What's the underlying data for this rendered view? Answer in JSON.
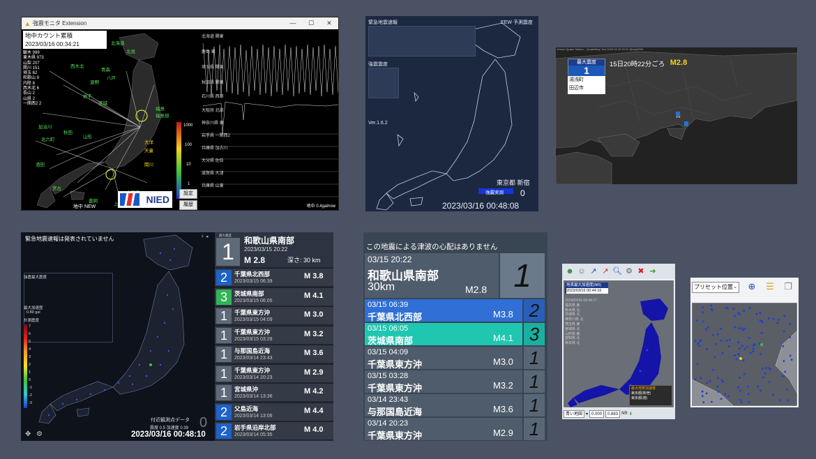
{
  "panel1": {
    "window_title": "強震モニタ Extension",
    "counter_title": "地中カウント累積",
    "counter_time": "2023/03/16 00:34:21",
    "stats": [
      "観木 999",
      "東木県 973",
      "山梨 207",
      "関川 151",
      "埼玉 62",
      "和歌山 9",
      "内陸 8",
      "西木北 6",
      "長山 2",
      "山県 2",
      "一関西2 2"
    ],
    "places_green": [
      "北海道",
      "北見",
      "帯広",
      "福島",
      "福島部",
      "宮城",
      "青森",
      "遠野",
      "大船渡",
      "岩手",
      "秋田",
      "山形",
      "酒田",
      "宮古",
      "盛岡",
      "八戸",
      "加治川"
    ],
    "places_yellow": [
      "大洋",
      "天童",
      "関川"
    ],
    "station_labels": [
      "北海道 関東",
      "鹿島 東",
      "埼玉県 関東",
      "秋田県 関東",
      "石川県 西部",
      "大阪府 北部",
      "神奈川県 東",
      "岩手県 一関西2",
      "兵庫県 加古川",
      "大分県 佐伯",
      "滋賀県 大津",
      "兵庫県 山東"
    ],
    "scale_labels": [
      "1000",
      "100",
      "10",
      "1"
    ],
    "buttons": [
      "設定",
      "履歴"
    ],
    "logo_text": "NIED",
    "bottom_left": "地中 NEW",
    "bottom_right": "地中 0.4gal/row"
  },
  "panel2": {
    "title": "緊急地震速報",
    "title_right": "EEW 予測震度",
    "label_intensity": "強震震度",
    "version": "Ver.1.6.2",
    "location": "東京都 新宿",
    "meter_label": "強震実測",
    "meter_value": "0",
    "datetime": "2023/03/16 00:48:08"
  },
  "panel3": {
    "header": "Kmoni Quake Station – QuakeMap Tool 2023.03.15 20:22 @eeq0309",
    "intensity_label": "最大震度",
    "intensity_value": "1",
    "time": "15日20時22分ごろ",
    "magnitude": "M2.8",
    "areas": [
      "湯浅町",
      "田辺市"
    ]
  },
  "panel4": {
    "message": "緊急地震速報は発表されていません",
    "labels": [
      "強震最大震度",
      "最大加速度",
      "0.89 gal",
      "計測震度"
    ],
    "scale_labels": [
      "7",
      "6",
      "5",
      "4",
      "3",
      "2",
      "1",
      "0",
      "-1",
      "-2",
      "-3"
    ],
    "nearby": "付近観測点データ",
    "nearby_values": "震度 0.5  加速度 0.39",
    "zero": "0",
    "datetime": "2023/03/16 00:48:10",
    "main": {
      "label": "最大震度",
      "intensity": "1",
      "name": "和歌山県南部",
      "datetime": "2023/03/15 20:22",
      "magnitude": "M 2.8",
      "depth": "深さ: 30 km"
    },
    "events": [
      {
        "intensity": "2",
        "color": "#1d62c8",
        "name": "千葉県北西部",
        "datetime": "2023/03/15 06:39",
        "magnitude": "M 3.8"
      },
      {
        "intensity": "3",
        "color": "#31b556",
        "name": "茨城県南部",
        "datetime": "2023/03/15 06:05",
        "magnitude": "M 4.1"
      },
      {
        "intensity": "1",
        "color": "#5e6a78",
        "name": "千葉県東方沖",
        "datetime": "2023/03/15 04:09",
        "magnitude": "M 3.0"
      },
      {
        "intensity": "1",
        "color": "#5e6a78",
        "name": "千葉県東方沖",
        "datetime": "2023/03/15 03:28",
        "magnitude": "M 3.2"
      },
      {
        "intensity": "1",
        "color": "#5e6a78",
        "name": "与那国島近海",
        "datetime": "2023/03/14 23:43",
        "magnitude": "M 3.6"
      },
      {
        "intensity": "1",
        "color": "#5e6a78",
        "name": "千葉県東方沖",
        "datetime": "2023/03/14 20:23",
        "magnitude": "M 2.9"
      },
      {
        "intensity": "1",
        "color": "#5e6a78",
        "name": "宮城県沖",
        "datetime": "2023/03/14 13:36",
        "magnitude": "M 4.2"
      },
      {
        "intensity": "2",
        "color": "#1d62c8",
        "name": "父島近海",
        "datetime": "2023/03/14 13:06",
        "magnitude": "M 4.4"
      },
      {
        "intensity": "2",
        "color": "#1d62c8",
        "name": "岩手県沿岸北部",
        "datetime": "2023/03/14 05:35",
        "magnitude": "M 4.0"
      }
    ]
  },
  "panel5": {
    "message": "この地震による津波の心配はありません",
    "main": {
      "datetime": "03/15  20:22",
      "name": "和歌山県南部",
      "depth": "30km",
      "magnitude": "M2.8",
      "intensity": "1"
    },
    "events": [
      {
        "datetime": "03/15  06:39",
        "name": "千葉県北西部",
        "magnitude": "M3.8",
        "intensity": "2",
        "color": "#2f6fd6",
        "icolor": "#2a5fb8"
      },
      {
        "datetime": "03/15  06:05",
        "name": "茨城県南部",
        "magnitude": "M4.1",
        "intensity": "3",
        "color": "#1fc7b1",
        "icolor": "#1ab0a0"
      },
      {
        "datetime": "03/15  04:09",
        "name": "千葉県東方沖",
        "magnitude": "M3.0",
        "intensity": "1",
        "color": "#4f5c6b",
        "icolor": "#586676"
      },
      {
        "datetime": "03/15  03:28",
        "name": "千葉県東方沖",
        "magnitude": "M3.2",
        "intensity": "1",
        "color": "#4f5c6b",
        "icolor": "#586676"
      },
      {
        "datetime": "03/14  23:43",
        "name": "与那国島近海",
        "magnitude": "M3.6",
        "intensity": "1",
        "color": "#4f5c6b",
        "icolor": "#586676"
      },
      {
        "datetime": "03/14  20:23",
        "name": "千葉県東方沖",
        "magnitude": "M2.9",
        "intensity": "1",
        "color": "#4f5c6b",
        "icolor": "#586676"
      }
    ]
  },
  "panel6": {
    "info_title": "地表最大加速度(NR)",
    "info_time": "2023/03/16 00:44:16",
    "list": [
      "2023/03/16 00:44:17",
      "福島県 東",
      "栃木県 北",
      "茨城県 北",
      "神奈川県 北",
      "埼玉県 東",
      "宮城県 北",
      "山形県 東",
      "愛知県 北",
      "岐阜県 北"
    ],
    "legend": [
      "最大地表加速度",
      "東京都(新宿)",
      "東京都(港)"
    ],
    "bottom_select": "青い地図",
    "field1": "0.000",
    "field2": "0.883",
    "nr_label": "NR"
  },
  "panel7": {
    "select": "プリセット位置"
  }
}
